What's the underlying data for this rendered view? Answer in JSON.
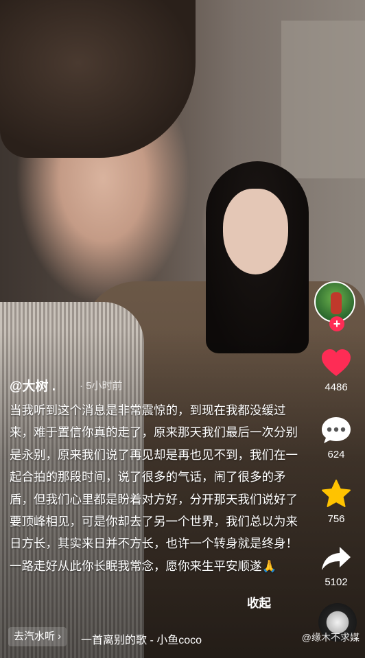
{
  "video": {
    "author": "@大树 .",
    "time": "· 5小时前",
    "caption": "当我听到这个消息是非常震惊的，到现在我都没缓过来，难于置信你真的走了，原来那天我们最后一次分别是永别，原来我们说了再见却是再也见不到，我们在一起合拍的那段时间，说了很多的气话，闹了很多的矛盾，但我们心里都是盼着对方好，分开那天我们说好了要顶峰相见，可是你却去了另一个世界，我们总以为来日方长，其实来日并不方长，也许一个转身就是终身！一路走好从此你长眠我常念，愿你来生平安顺遂🙏",
    "collapse": "收起"
  },
  "actions": {
    "like_count": "4486",
    "comment_count": "624",
    "favorite_count": "756",
    "share_count": "5102"
  },
  "music": {
    "tag": "去汽水听 ›",
    "title": "一首离别的歌 - 小鱼coco"
  },
  "watermark": "@缘木不求媒",
  "colors": {
    "like": "#fe2c55",
    "favorite": "#ffc300",
    "follow": "#fe2c55"
  }
}
